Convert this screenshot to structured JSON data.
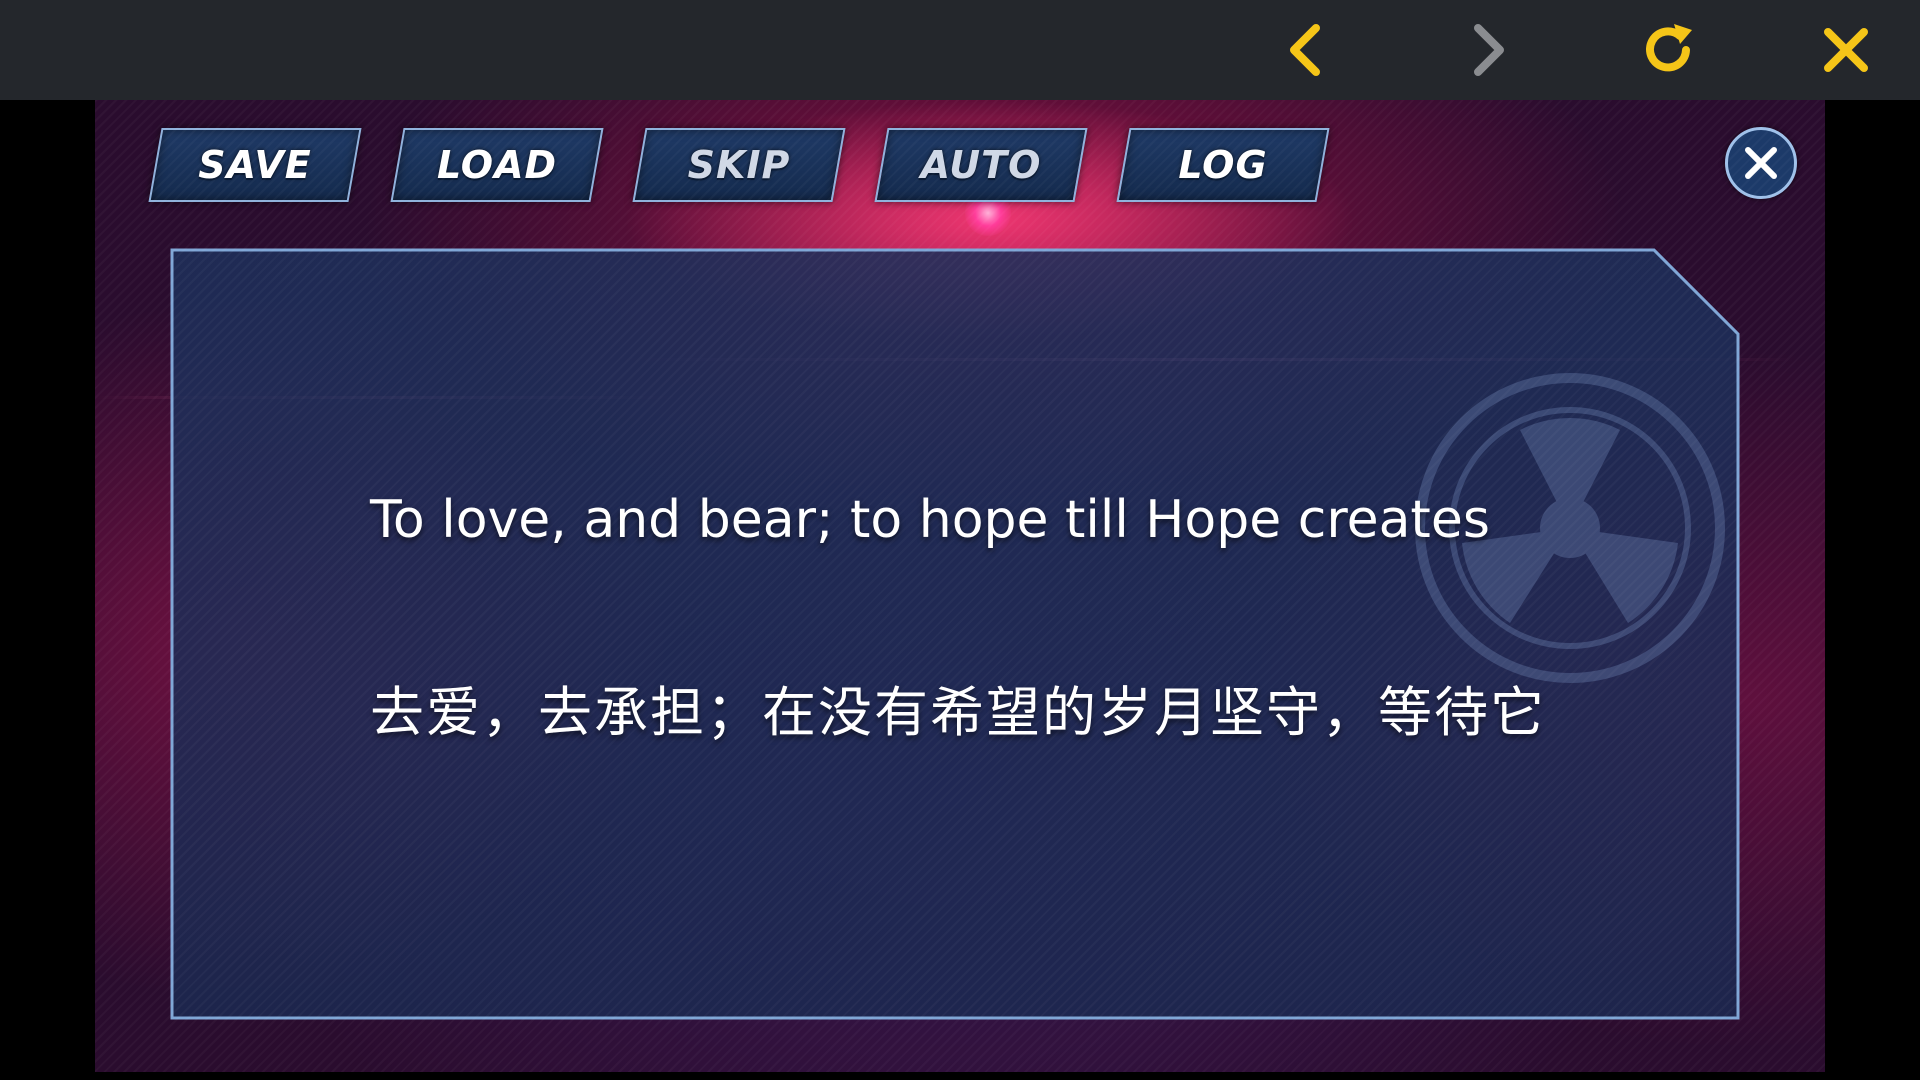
{
  "browser_bar": {
    "back_icon": "chevron-left-icon",
    "forward_icon": "chevron-right-icon",
    "reload_icon": "reload-icon",
    "close_icon": "close-icon",
    "accent_color": "#f5c518",
    "disabled_color": "#8a8c90"
  },
  "game_menu": {
    "save_label": "SAVE",
    "load_label": "LOAD",
    "skip_label": "SKIP",
    "auto_label": "AUTO",
    "log_label": "LOG",
    "close_icon": "close-circle-icon"
  },
  "dialog": {
    "line_en": "To love, and bear; to hope till Hope creates",
    "line_zh": "去爱，去承担；在没有希望的岁月坚守，等待它"
  }
}
